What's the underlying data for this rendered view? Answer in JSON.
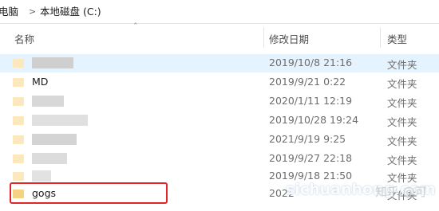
{
  "breadcrumb": {
    "prev": "电脑",
    "sep": ">",
    "current": "本地磁盘 (C:)"
  },
  "columns": {
    "name": "名称",
    "date": "修改日期",
    "type": "类型"
  },
  "rows": [
    {
      "name": "",
      "date": "2019/10/8 21:16",
      "type": "文件夹"
    },
    {
      "name": "MD",
      "date": "2019/9/21 0:22",
      "type": "文件夹"
    },
    {
      "name": "",
      "date": "2020/1/11 12:19",
      "type": "文件夹"
    },
    {
      "name": "",
      "date": "2019/10/28 19:24",
      "type": "文件夹"
    },
    {
      "name": "",
      "date": "2021/9/19 9:25",
      "type": "文件夹"
    },
    {
      "name": "",
      "date": "2019/9/27 22:18",
      "type": "文件夹"
    },
    {
      "name": "",
      "date": "2019/9/18 21:50",
      "type": "文件夹"
    },
    {
      "name": "gogs",
      "date": "2022",
      "type": "文件夹"
    }
  ],
  "watermark": {
    "text": "sichuanhong.com",
    "logo": "知乎 @可"
  },
  "colors": {
    "selected": "#e5f3ff",
    "highlight": "#e0262c",
    "folder": "#f5d382"
  }
}
